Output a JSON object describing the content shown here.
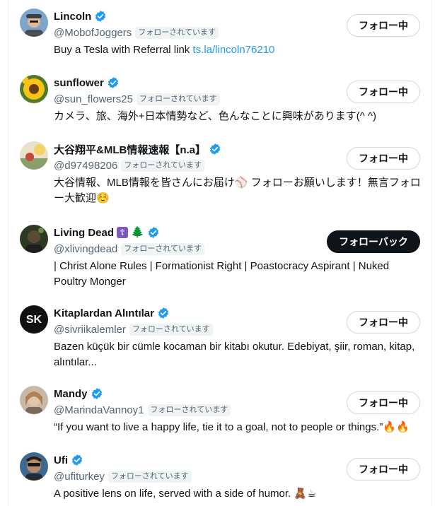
{
  "users": [
    {
      "name": "Lincoln",
      "handle": "@MobofJoggers",
      "follows_you": "フォローされています",
      "bio_text": "Buy a Tesla with Referral link ",
      "bio_link": "ts.la/lincoln76210",
      "button": "フォロー中",
      "avatar_icon": "person-with-cap-avatar"
    },
    {
      "name": "sunflower",
      "handle": "@sun_flowers25",
      "follows_you": "フォローされています",
      "bio_text": "カメラ、旅、海外+日本情勢など、色んなことに興味があります(^ ^)",
      "button": "フォロー中",
      "avatar_icon": "sunflower-avatar"
    },
    {
      "name": "大谷翔平&MLB情報速報【n.a】",
      "handle": "@d97498206",
      "follows_you": "フォローされています",
      "bio_text": "大谷情報、MLB情報を皆さんにお届け⚾️ フォローお願いします！無言フォロー大歓迎☺️",
      "button": "フォロー中",
      "avatar_icon": "baseball-photo-avatar"
    },
    {
      "name": "Living Dead",
      "name_extra_icons": [
        "☦",
        "🌲"
      ],
      "handle": "@xlivingdead",
      "follows_you": "フォローされています",
      "bio_text": "| Christ Alone Rules | Formationist Right | Poastocracy Aspirant | Nuked Poultry Monger",
      "button": "フォローバック",
      "avatar_icon": "dark-figure-avatar"
    },
    {
      "name": "Kitaplardan Alıntılar",
      "handle": "@sivriikalemler",
      "follows_you": "フォローされています",
      "bio_text": "Bazen küçük bir cümle kocaman bir kitabı okutur. Edebiyat, şiir, roman, kitap, alıntılar...",
      "button": "フォロー中",
      "avatar_icon": "sk-logo-avatar",
      "avatar_text": "SK"
    },
    {
      "name": "Mandy",
      "handle": "@MarindaVannoy1",
      "follows_you": "フォローされています",
      "bio_text": "“If you want to live a happy life, tie it to a goal, not to people or things.”🔥🔥",
      "button": "フォロー中",
      "avatar_icon": "woman-portrait-avatar"
    },
    {
      "name": "Ufi",
      "handle": "@ufiturkey",
      "follows_you": "フォローされています",
      "bio_text": "A positive lens on life, served with a side of humor. 🧸☕",
      "button": "フォロー中",
      "avatar_icon": "man-sunglasses-avatar"
    }
  ],
  "colors": {
    "verified_badge": "#1d9bf0",
    "link": "#1d9bf0",
    "secondary_text": "#536471",
    "primary_text": "#0f1419",
    "follows_you_bg": "#eff3f4"
  }
}
